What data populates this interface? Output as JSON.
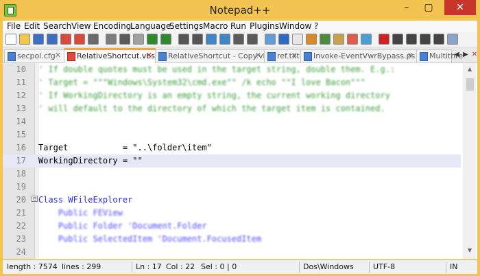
{
  "window": {
    "title": "Notepad++",
    "min": "–",
    "max": "▢",
    "close": "✕"
  },
  "menu": [
    "File",
    "Edit",
    "Search",
    "View",
    "Encoding",
    "Language",
    "Settings",
    "Macro",
    "Run",
    "Plugins",
    "Window",
    "?"
  ],
  "tabs": [
    {
      "label": "secpol.cfg",
      "active": false
    },
    {
      "label": "RelativeShortcut.vbs",
      "active": true
    },
    {
      "label": "RelativeShortcut - Copy.vbs",
      "active": false
    },
    {
      "label": "ref.txt",
      "active": false
    },
    {
      "label": "Invoke-EventVwrBypass.ps1",
      "active": false
    },
    {
      "label": "Multithre",
      "active": false
    }
  ],
  "tab_close": "✕",
  "nav": {
    "left": "◀",
    "right": "▶",
    "close": "✕"
  },
  "lines": [
    {
      "n": "10",
      "text": "' If double quotes must be used in the target string, double them. E.g.:",
      "style": "comment-blur"
    },
    {
      "n": "11",
      "text": "' Target = \"\"\"Windows\\System32\\cmd.exe\"\" /k echo \"\"I love Bacon\"\"\"",
      "style": "comment-blur"
    },
    {
      "n": "12",
      "text": "' If WorkingDirectory is an empty string, the current working directory",
      "style": "comment-blur"
    },
    {
      "n": "13",
      "text": "' will default to the directory of which the target item is contained.",
      "style": "comment-blur"
    },
    {
      "n": "14",
      "text": "",
      "style": "plain"
    },
    {
      "n": "15",
      "text": "",
      "style": "plain"
    },
    {
      "n": "16",
      "text": "Target           = \"..\\folder\\item\"",
      "style": "plain"
    },
    {
      "n": "17",
      "text": "WorkingDirectory = \"\"",
      "style": "current"
    },
    {
      "n": "18",
      "text": "",
      "style": "plain"
    },
    {
      "n": "19",
      "text": "",
      "style": "plain"
    },
    {
      "n": "20",
      "text": "Class WFileExplorer",
      "style": "class"
    },
    {
      "n": "21",
      "text": "    Public FEView",
      "style": "public-blur"
    },
    {
      "n": "22",
      "text": "    Public Folder 'Document.Folder",
      "style": "public-blur"
    },
    {
      "n": "23",
      "text": "    Public SelectedItem 'Document.FocusedItem",
      "style": "public-blur"
    },
    {
      "n": "24",
      "text": "",
      "style": "plain"
    }
  ],
  "fold_marker": "⊟",
  "status": {
    "length": "length : 7574",
    "lines": "lines : 299",
    "ln": "Ln : 17",
    "col": "Col : 22",
    "sel": "Sel : 0 | 0",
    "eol": "Dos\\Windows",
    "encoding": "UTF-8",
    "mode": "IN"
  },
  "toolbar_icons": [
    "new-file-icon",
    "open-file-icon",
    "save-icon",
    "save-all-icon",
    "close-icon",
    "close-all-icon",
    "print-icon",
    "cut-icon",
    "copy-icon",
    "paste-icon",
    "undo-icon",
    "redo-icon",
    "find-icon",
    "replace-icon",
    "zoom-in-icon",
    "zoom-out-icon",
    "sync-vertical-icon",
    "sync-horizontal-icon",
    "word-wrap-icon",
    "show-all-chars-icon",
    "indent-guide-icon",
    "user-language-icon",
    "doc-map-icon",
    "function-list-icon",
    "folder-workspace-icon",
    "monitor-icon",
    "record-macro-icon",
    "stop-macro-icon",
    "play-macro-icon",
    "run-macro-icon",
    "save-macro-icon",
    "spell-check-icon"
  ]
}
